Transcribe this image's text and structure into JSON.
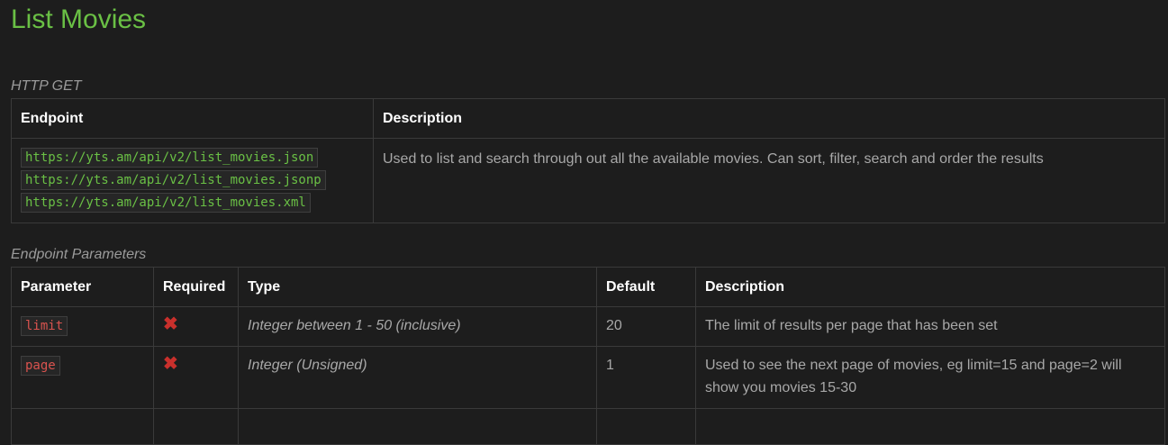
{
  "page": {
    "title": "List Movies"
  },
  "http": {
    "method_caption": "HTTP GET",
    "headers": {
      "endpoint": "Endpoint",
      "description": "Description"
    },
    "endpoints": [
      "https://yts.am/api/v2/list_movies.json",
      "https://yts.am/api/v2/list_movies.jsonp",
      "https://yts.am/api/v2/list_movies.xml"
    ],
    "description": "Used to list and search through out all the available movies. Can sort, filter, search and order the results"
  },
  "params": {
    "caption": "Endpoint Parameters",
    "headers": {
      "parameter": "Parameter",
      "required": "Required",
      "type": "Type",
      "default": "Default",
      "description": "Description"
    },
    "rows": [
      {
        "name": "limit",
        "required_icon": "cross-icon",
        "required_glyph": "✖",
        "type": "Integer between 1 - 50 (inclusive)",
        "default": "20",
        "description": "The limit of results per page that has been set"
      },
      {
        "name": "page",
        "required_icon": "cross-icon",
        "required_glyph": "✖",
        "type": "Integer (Unsigned)",
        "default": "1",
        "description": "Used to see the next page of movies, eg limit=15 and page=2 will show you movies 15-30"
      }
    ]
  },
  "colors": {
    "background": "#1d1d1d",
    "title_green": "#6ac045",
    "code_green": "#6ac045",
    "code_red": "#d9534f",
    "cross_red": "#c9302c",
    "border": "#3a3a3a"
  }
}
